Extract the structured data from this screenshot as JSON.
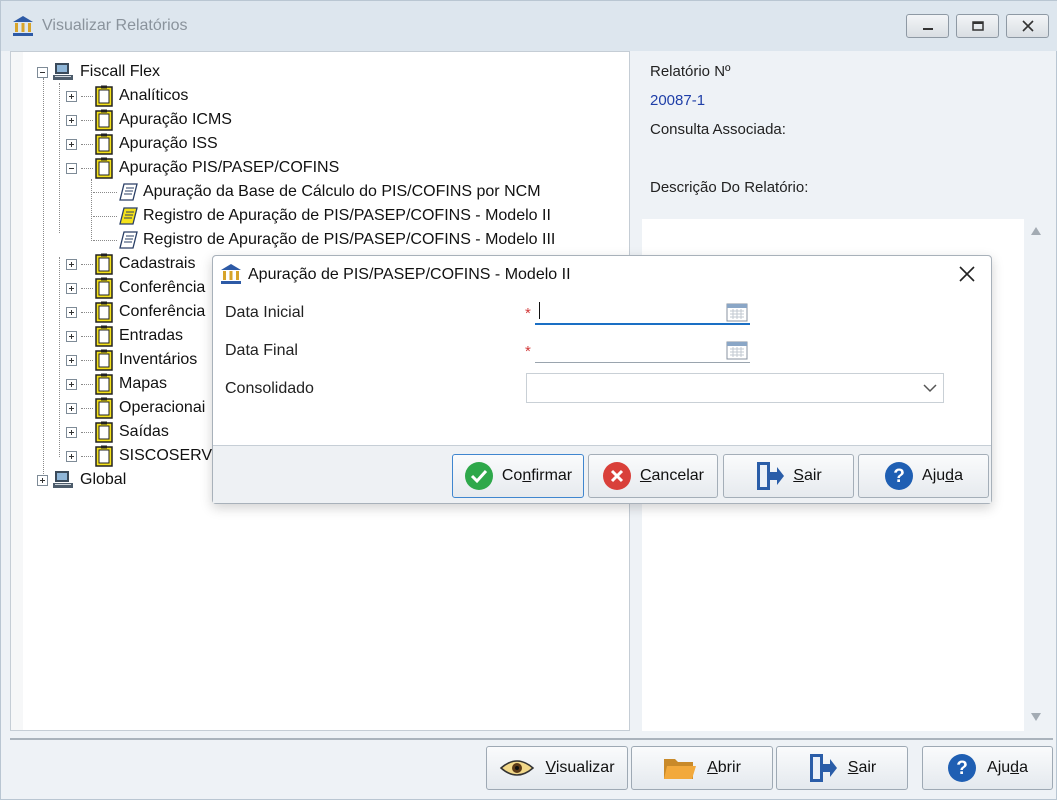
{
  "window": {
    "title": "Visualizar Relatórios",
    "controls": {
      "minimize": "minimize-icon",
      "restore": "restore-icon",
      "close": "close-icon"
    }
  },
  "tree": {
    "root1": "Fiscall Flex",
    "items": [
      "Analíticos",
      "Apuração ICMS",
      "Apuração ISS",
      "Apuração PIS/PASEP/COFINS"
    ],
    "sub_items": [
      "Apuração da Base de Cálculo do PIS/COFINS por NCM",
      "Registro de Apuração de PIS/PASEP/COFINS - Modelo II",
      "Registro de Apuração de PIS/PASEP/COFINS - Modelo III"
    ],
    "items2": [
      "Cadastrais",
      "Conferência",
      "Conferência",
      "Entradas",
      "Inventários",
      "Mapas",
      "Operacionai",
      "Saídas",
      "SISCOSERV"
    ],
    "root2": "Global"
  },
  "info": {
    "report_number_label": "Relatório Nº",
    "report_number": "20087-1",
    "associated_query_label": "Consulta Associada:",
    "description_label": "Descrição Do Relatório:"
  },
  "bottom_buttons": {
    "view": {
      "pre": "",
      "u": "V",
      "post": "isualizar"
    },
    "open": {
      "pre": "",
      "u": "A",
      "post": "brir"
    },
    "exit": {
      "pre": "",
      "u": "S",
      "post": "air"
    },
    "help": {
      "pre": "Aju",
      "u": "d",
      "post": "a"
    }
  },
  "dialog": {
    "title": "Apuração de PIS/PASEP/COFINS - Modelo II",
    "fields": {
      "start_date_label": "Data Inicial",
      "start_date_value": "",
      "end_date_label": "Data Final",
      "end_date_value": "",
      "consolidated_label": "Consolidado",
      "consolidated_value": "",
      "required_mark": "*"
    },
    "buttons": {
      "confirm": {
        "pre": "Co",
        "u": "n",
        "post": "firmar"
      },
      "cancel": {
        "pre": "",
        "u": "C",
        "post": "ancelar"
      },
      "exit": {
        "pre": "",
        "u": "S",
        "post": "air"
      },
      "help": {
        "pre": "Aju",
        "u": "d",
        "post": "a"
      }
    }
  },
  "colors": {
    "accent": "#1a6fc4",
    "value_text": "#1f3fa8",
    "required": "#d23a3a",
    "confirm_green": "#2ea84a",
    "cancel_red": "#d9403a",
    "help_blue": "#1f5fb3"
  }
}
